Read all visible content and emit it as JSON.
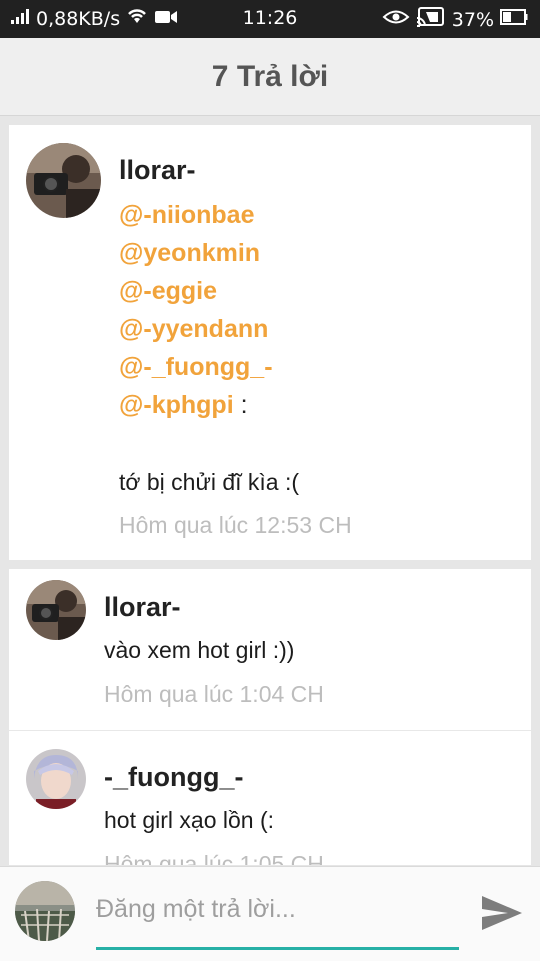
{
  "status_bar": {
    "speed": "0,88KB/s",
    "time": "11:26",
    "battery": "37%",
    "icons": [
      "signal-icon",
      "wifi-icon",
      "video-icon",
      "eye-icon",
      "cast-icon",
      "battery-icon"
    ]
  },
  "header": {
    "title": "7 Trả lời"
  },
  "comments": [
    {
      "author": "llorar-",
      "mentions": [
        "@-niionbae",
        "@yeonkmin",
        "@-eggie",
        "@-yyendann",
        "@-_fuongg_-",
        "@-kphgpi"
      ],
      "mention_suffix": " :",
      "text": "tớ bị chửi đĩ kìa :(",
      "time": "Hôm qua lúc 12:53 CH"
    },
    {
      "author": "llorar-",
      "text": "vào xem hot girl :))",
      "time": "Hôm qua lúc 1:04 CH"
    },
    {
      "author": "-_fuongg_-",
      "text": "hot girl xạo lồn (:",
      "time": "Hôm qua lúc 1:05 CH"
    }
  ],
  "reply": {
    "placeholder": "Đăng một trả lời..."
  },
  "colors": {
    "mention": "#f1a33b",
    "accent": "#27b0a6",
    "timestamp": "#bdbdbd"
  }
}
